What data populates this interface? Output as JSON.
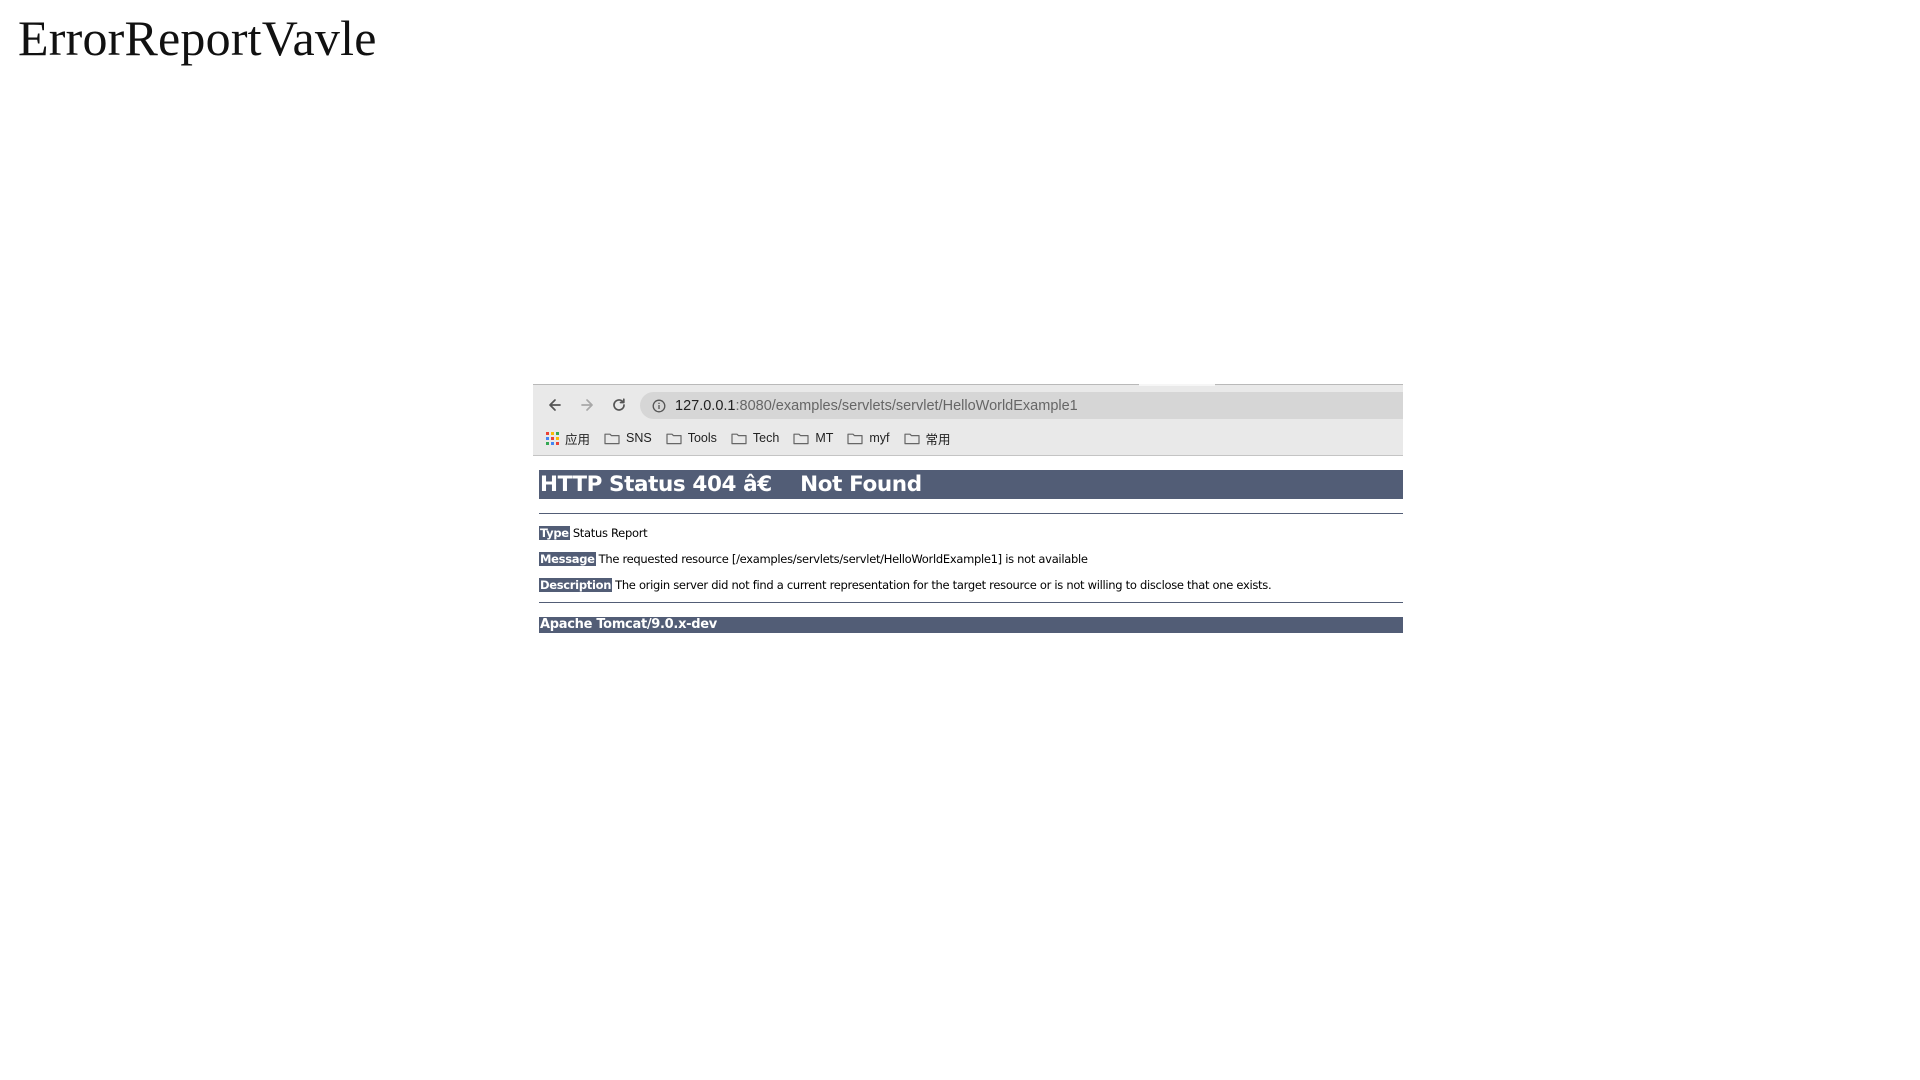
{
  "slide": {
    "title": "ErrorReportVavle"
  },
  "browser": {
    "nav": {
      "back_icon": "arrow-left-icon",
      "forward_icon": "arrow-right-icon",
      "reload_icon": "reload-icon"
    },
    "address_bar": {
      "icon": "info-icon",
      "url_host": "127.0.0.1",
      "url_rest": ":8080/examples/servlets/servlet/HelloWorldExample1"
    },
    "bookmarks": [
      {
        "label": "应用",
        "icon": "apps-grid-icon"
      },
      {
        "label": "SNS",
        "icon": "folder-icon"
      },
      {
        "label": "Tools",
        "icon": "folder-icon"
      },
      {
        "label": "Tech",
        "icon": "folder-icon"
      },
      {
        "label": "MT",
        "icon": "folder-icon"
      },
      {
        "label": "myf",
        "icon": "folder-icon"
      },
      {
        "label": "常用",
        "icon": "folder-icon"
      }
    ],
    "colors": {
      "toolbar_bg": "#e9e9e9",
      "omnibox_bg": "#d6d6d6"
    }
  },
  "error_page": {
    "heading": "HTTP Status 404 â€    Not Found",
    "rows": [
      {
        "label": "Type",
        "text": "Status Report"
      },
      {
        "label": "Message",
        "text": "The requested resource [/examples/servlets/servlet/HelloWorldExample1] is not available"
      },
      {
        "label": "Description",
        "text": "The origin server did not find a current representation for the target resource or is not willing to disclose that one exists."
      }
    ],
    "footer": "Apache Tomcat/9.0.x-dev",
    "colors": {
      "accent": "#525d76"
    }
  }
}
